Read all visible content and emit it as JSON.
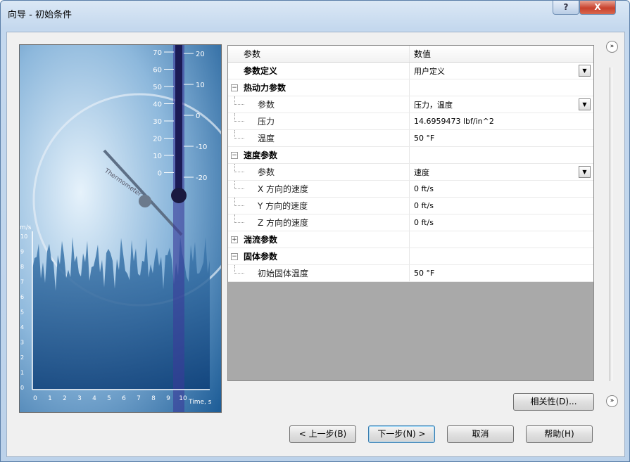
{
  "window": {
    "title": "向导 - 初始条件",
    "help": "?",
    "close": "X"
  },
  "image": {
    "y_ticks_left": [
      "70",
      "60",
      "50",
      "40",
      "30",
      "20",
      "10",
      "0"
    ],
    "y_ticks_right": [
      "20",
      "10",
      "0",
      "-10",
      "-20"
    ],
    "chart_y_label": "m/s",
    "chart_y_ticks": [
      "10",
      "9",
      "8",
      "7",
      "6",
      "5",
      "4",
      "3",
      "2",
      "1",
      "0"
    ],
    "chart_x_ticks": [
      "0",
      "1",
      "2",
      "3",
      "4",
      "5",
      "6",
      "7",
      "8",
      "9",
      "10"
    ],
    "chart_x_label": "Time, s",
    "gauge_label": "Thermometer"
  },
  "grid": {
    "header": {
      "name": "参数",
      "value": "数值"
    },
    "rows": [
      {
        "type": "top",
        "name": "参数定义",
        "value": "用户定义",
        "dropdown": true
      },
      {
        "type": "cat",
        "name": "热动力参数",
        "value": "",
        "expander": "−"
      },
      {
        "type": "sub",
        "name": "参数",
        "value": "压力，温度",
        "dropdown": true
      },
      {
        "type": "sub",
        "name": "压力",
        "value": "14.6959473 lbf/in^2"
      },
      {
        "type": "sub",
        "name": "温度",
        "value": "50 °F"
      },
      {
        "type": "cat",
        "name": "速度参数",
        "value": "",
        "expander": "−"
      },
      {
        "type": "sub",
        "name": "参数",
        "value": "速度",
        "dropdown": true
      },
      {
        "type": "sub",
        "name": "X 方向的速度",
        "value": "0 ft/s"
      },
      {
        "type": "sub",
        "name": "Y 方向的速度",
        "value": "0 ft/s"
      },
      {
        "type": "sub",
        "name": "Z 方向的速度",
        "value": "0 ft/s"
      },
      {
        "type": "cat",
        "name": "湍流参数",
        "value": "",
        "expander": "+"
      },
      {
        "type": "cat",
        "name": "固体参数",
        "value": "",
        "expander": "−"
      },
      {
        "type": "sub",
        "name": "初始固体温度",
        "value": "50 °F"
      }
    ]
  },
  "buttons": {
    "dependency": "相关性(D)...",
    "back": "< 上一步(B)",
    "next": "下一步(N) >",
    "cancel": "取消",
    "help": "帮助(H)",
    "more": "»"
  }
}
